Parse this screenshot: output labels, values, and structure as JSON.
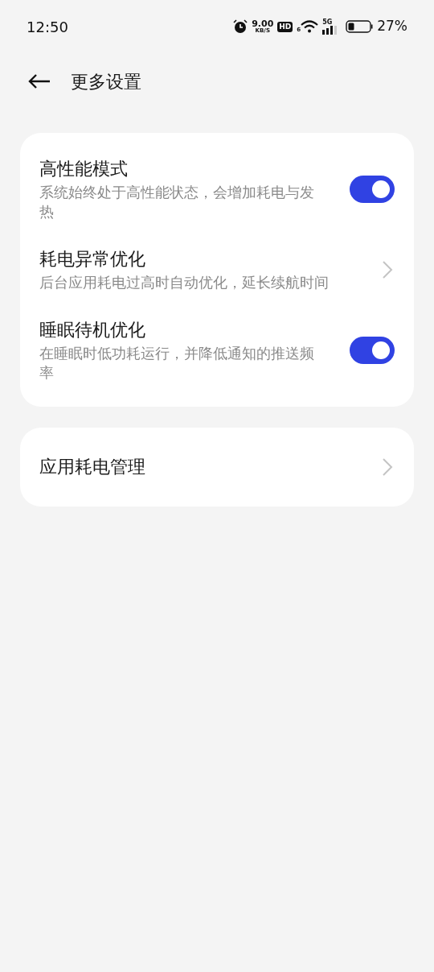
{
  "status_bar": {
    "time": "12:50",
    "speed": "9.00",
    "speed_unit": "KB/S",
    "hd": "HD",
    "wifi_badge": "6",
    "network": "5G",
    "battery": "27%"
  },
  "header": {
    "title": "更多设置"
  },
  "groups": [
    {
      "items": [
        {
          "kind": "toggle",
          "title": "高性能模式",
          "description": "系统始终处于高性能状态，会增加耗电与发热",
          "on": true
        },
        {
          "kind": "link",
          "title": "耗电异常优化",
          "description": "后台应用耗电过高时自动优化，延长续航时间"
        },
        {
          "kind": "toggle",
          "title": "睡眠待机优化",
          "description": "在睡眠时低功耗运行，并降低通知的推送频率",
          "on": true
        }
      ]
    },
    {
      "items": [
        {
          "kind": "link",
          "title": "应用耗电管理"
        }
      ]
    }
  ]
}
